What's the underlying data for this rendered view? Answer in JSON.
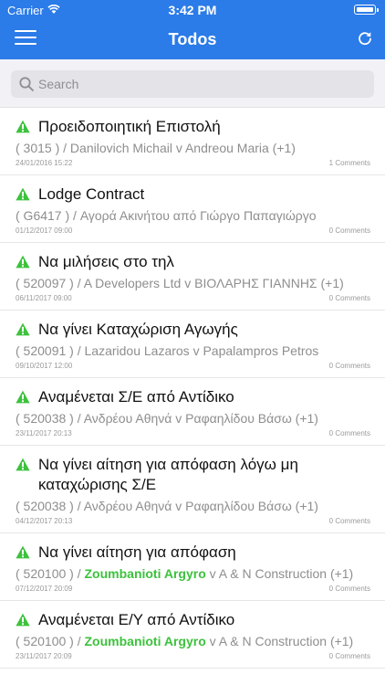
{
  "status_bar": {
    "carrier": "Carrier",
    "time": "3:42 PM"
  },
  "nav": {
    "title": "Todos",
    "menu_icon": "hamburger-menu-icon",
    "refresh_icon": "refresh-icon"
  },
  "search": {
    "placeholder": "Search",
    "value": ""
  },
  "colors": {
    "header": "#2b7be8",
    "warning": "#3cc23c",
    "highlight_name": "#3cc23c"
  },
  "todos": [
    {
      "title": "Προειδοποιητική Επιστολή",
      "code": "( 3015 ) / ",
      "highlight": "",
      "parties": "Danilovich Michail v Andreou Maria (+1)",
      "date": "24/01/2016 15:22",
      "comments": "1 Comments"
    },
    {
      "title": "Lodge Contract",
      "code": "( G6417 ) / ",
      "highlight": "",
      "parties": "Αγορά Ακινήτου από Γιώργο Παπαγιώργο",
      "date": "01/12/2017 09:00",
      "comments": "0 Comments"
    },
    {
      "title": "Να μιλήσεις στο τηλ",
      "code": "( 520097 ) / ",
      "highlight": "",
      "parties": "A Developers Ltd v ΒΙΟΛΑΡΗΣ ΓΙΑΝΝΗΣ (+1)",
      "date": "06/11/2017 09:00",
      "comments": "0 Comments"
    },
    {
      "title": "Να γίνει Καταχώριση Αγωγής",
      "code": "( 520091 ) / ",
      "highlight": "",
      "parties": "Lazaridou Lazaros v Papalampros Petros",
      "date": "09/10/2017 12:00",
      "comments": "0 Comments"
    },
    {
      "title": "Αναμένεται Σ/Ε από Αντίδικο",
      "code": "( 520038 ) / ",
      "highlight": "",
      "parties": "Ανδρέου Αθηνά v Ραφαηλίδου Βάσω (+1)",
      "date": "23/11/2017 20:13",
      "comments": "0 Comments"
    },
    {
      "title": "Να γίνει αίτηση για απόφαση λόγω μη καταχώρισης Σ/Ε",
      "code": "( 520038 ) / ",
      "highlight": "",
      "parties": "Ανδρέου Αθηνά v Ραφαηλίδου Βάσω (+1)",
      "date": "04/12/2017 20:13",
      "comments": "0 Comments"
    },
    {
      "title": "Να γίνει αίτηση για απόφαση",
      "code": "( 520100 ) / ",
      "highlight": "Zoumbanioti Argyro",
      "parties": " v A & N Construction (+1)",
      "date": "07/12/2017 20:09",
      "comments": "0 Comments"
    },
    {
      "title": "Αναμένεται Ε/Υ από Αντίδικο",
      "code": "( 520100 ) / ",
      "highlight": "Zoumbanioti Argyro",
      "parties": " v A & N Construction (+1)",
      "date": "23/11/2017 20:09",
      "comments": "0 Comments"
    }
  ]
}
